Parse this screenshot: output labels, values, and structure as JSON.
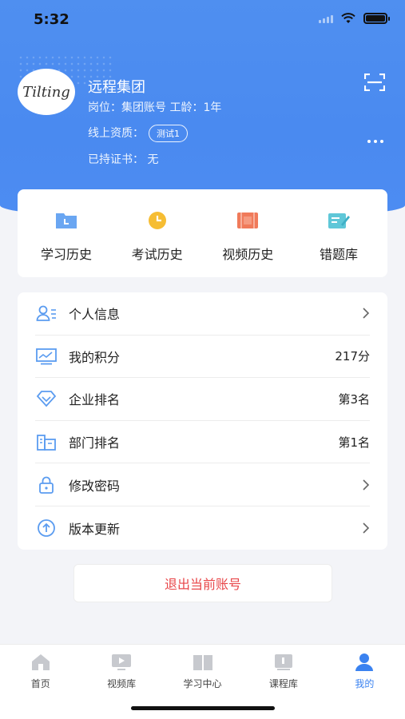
{
  "status_bar": {
    "time": "5:32"
  },
  "profile": {
    "avatar_text": "Tilting",
    "company": "远程集团",
    "position_line": "岗位：集团账号  工龄：1年",
    "qualification_label": "线上资质：",
    "qualification_badge": "测试1",
    "certificate_line": "已持证书：  无"
  },
  "quick_actions": [
    {
      "label": "学习历史",
      "icon": "folder-icon",
      "color": "#5b9cf0"
    },
    {
      "label": "考试历史",
      "icon": "clock-icon",
      "color": "#f5b82e"
    },
    {
      "label": "视频历史",
      "icon": "film-icon",
      "color": "#f07a5a"
    },
    {
      "label": "错题库",
      "icon": "edit-note-icon",
      "color": "#4fc1d6"
    }
  ],
  "menu": [
    {
      "label": "个人信息",
      "value": "",
      "icon": "user-info-icon"
    },
    {
      "label": "我的积分",
      "value": "217分",
      "icon": "chart-monitor-icon"
    },
    {
      "label": "企业排名",
      "value": "第3名",
      "icon": "diamond-icon"
    },
    {
      "label": "部门排名",
      "value": "第1名",
      "icon": "building-icon"
    },
    {
      "label": "修改密码",
      "value": "",
      "icon": "lock-icon"
    },
    {
      "label": "版本更新",
      "value": "",
      "icon": "upload-circle-icon"
    }
  ],
  "logout_label": "退出当前账号",
  "tabs": [
    {
      "label": "首页",
      "icon": "home-icon"
    },
    {
      "label": "视频库",
      "icon": "video-icon"
    },
    {
      "label": "学习中心",
      "icon": "book-icon"
    },
    {
      "label": "课程库",
      "icon": "course-icon"
    },
    {
      "label": "我的",
      "icon": "person-icon",
      "active": true
    }
  ],
  "colors": {
    "primary": "#4a8af0",
    "danger": "#e8474a",
    "icon_blue": "#5b9cf0"
  }
}
